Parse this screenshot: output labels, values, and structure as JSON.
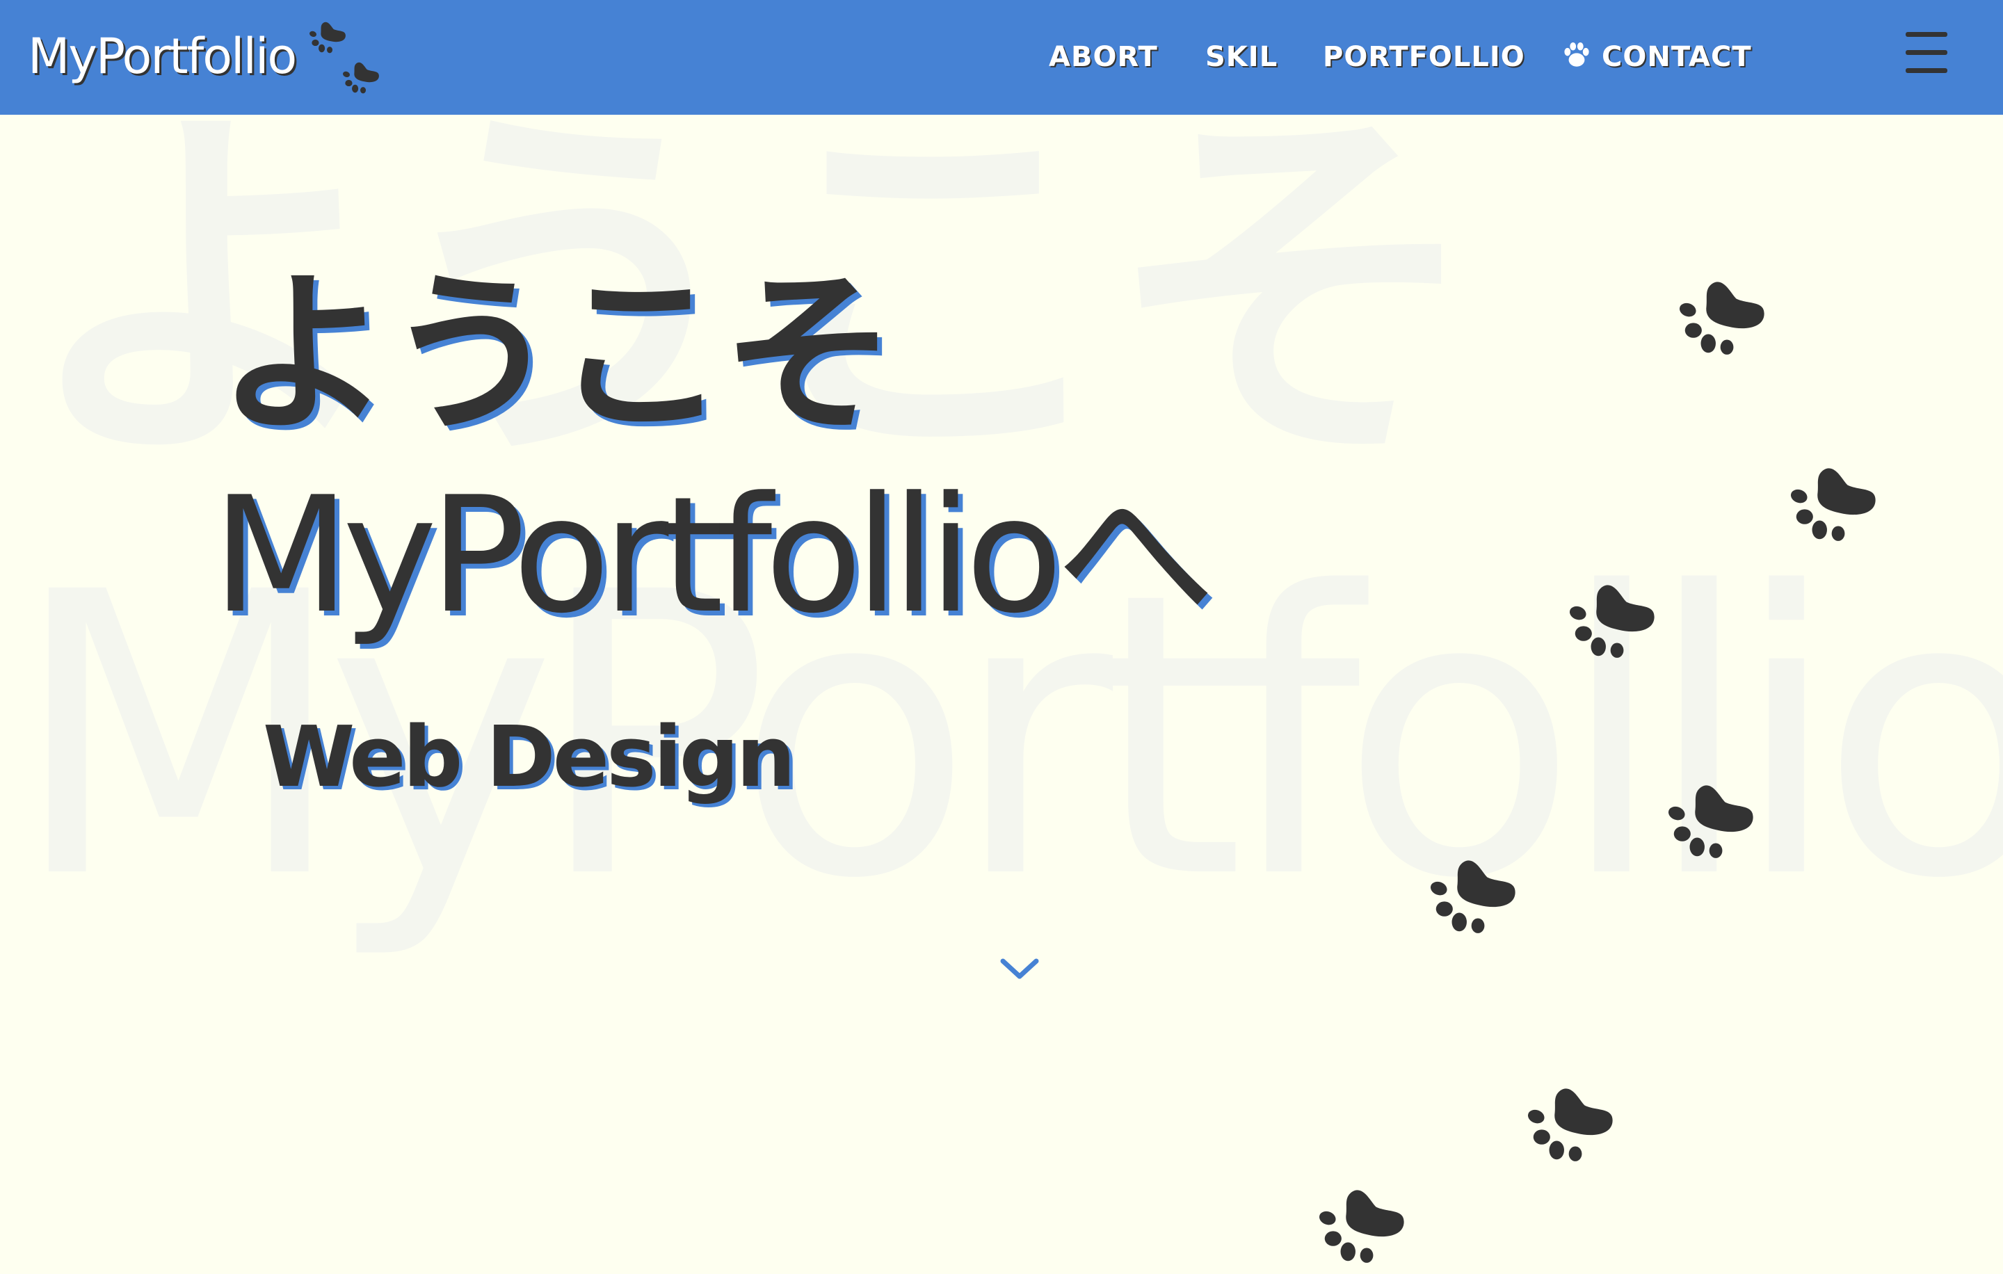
{
  "header": {
    "logo_text": "MyPortfollio",
    "logo_icon": "paw-prints-icon",
    "nav": [
      {
        "label": "ABORT"
      },
      {
        "label": "SKIL"
      },
      {
        "label": "PORTFOLLIO"
      },
      {
        "label": "CONTACT",
        "icon": "paw-icon"
      }
    ],
    "menu_icon": "hamburger-menu-icon"
  },
  "hero": {
    "background_jp": "ようこそ",
    "background_en": "MyPortfollio",
    "title_jp": "ようこそ",
    "title_en": "MyPortfollioへ",
    "subtitle": "Web Design",
    "scroll_icon": "chevron-down-icon"
  },
  "decor": {
    "paw_icon": "paw-print-icon",
    "paw_count": 8
  },
  "colors": {
    "header_bg": "#4682d4",
    "page_bg": "#fefff0",
    "text": "#333333",
    "accent": "#4682d4"
  }
}
